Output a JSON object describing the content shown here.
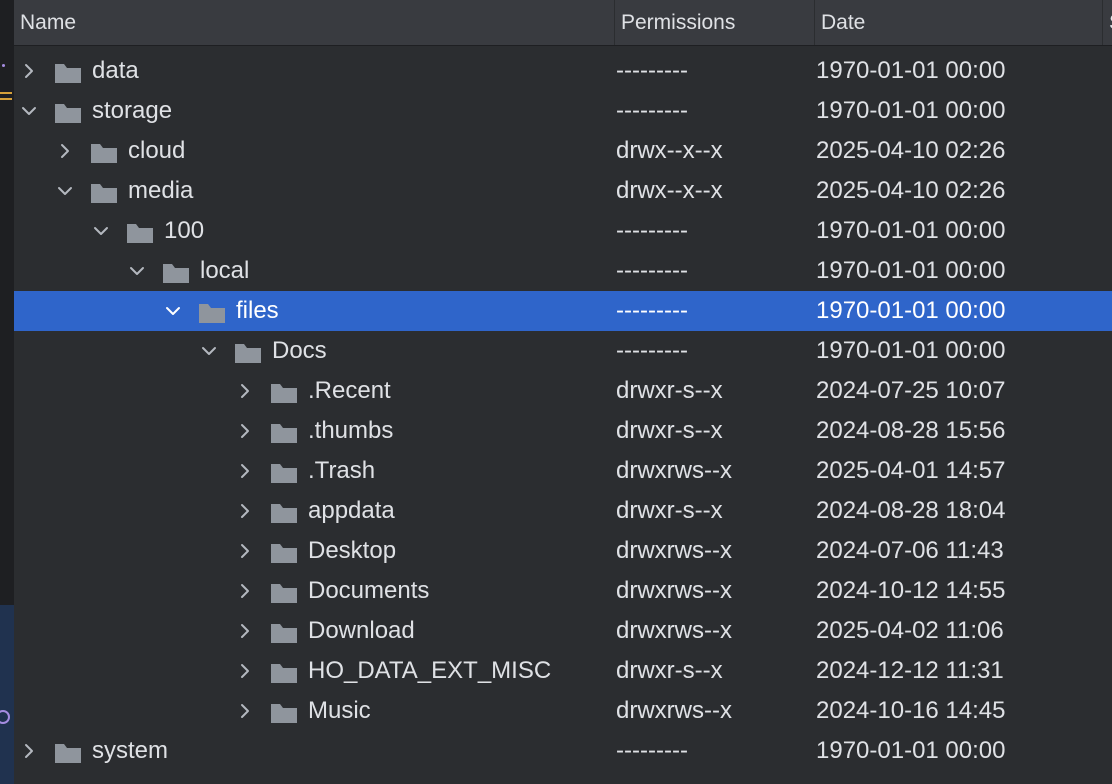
{
  "colors": {
    "background": "#2b2d30",
    "header_background": "#393b40",
    "selection": "#2f65ca",
    "folder_icon": "#8f959d",
    "text": "#dfe1e5"
  },
  "header": {
    "name_label": "Name",
    "permissions_label": "Permissions",
    "date_label": "Date",
    "size_label": "S"
  },
  "rows": [
    {
      "name": "data",
      "permissions": "---------",
      "date": "1970-01-01 00:00",
      "expanded": false,
      "selected": false,
      "icon": "folder-icon"
    },
    {
      "name": "storage",
      "permissions": "---------",
      "date": "1970-01-01 00:00",
      "expanded": true,
      "selected": false,
      "icon": "folder-icon"
    },
    {
      "name": "cloud",
      "permissions": "drwx--x--x",
      "date": "2025-04-10 02:26",
      "expanded": false,
      "selected": false,
      "icon": "folder-icon"
    },
    {
      "name": "media",
      "permissions": "drwx--x--x",
      "date": "2025-04-10 02:26",
      "expanded": true,
      "selected": false,
      "icon": "folder-icon"
    },
    {
      "name": "100",
      "permissions": "---------",
      "date": "1970-01-01 00:00",
      "expanded": true,
      "selected": false,
      "icon": "folder-icon"
    },
    {
      "name": "local",
      "permissions": "---------",
      "date": "1970-01-01 00:00",
      "expanded": true,
      "selected": false,
      "icon": "folder-icon"
    },
    {
      "name": "files",
      "permissions": "---------",
      "date": "1970-01-01 00:00",
      "expanded": true,
      "selected": true,
      "icon": "folder-icon"
    },
    {
      "name": "Docs",
      "permissions": "---------",
      "date": "1970-01-01 00:00",
      "expanded": true,
      "selected": false,
      "icon": "folder-icon"
    },
    {
      "name": ".Recent",
      "permissions": "drwxr-s--x",
      "date": "2024-07-25 10:07",
      "expanded": false,
      "selected": false,
      "icon": "folder-icon"
    },
    {
      "name": ".thumbs",
      "permissions": "drwxr-s--x",
      "date": "2024-08-28 15:56",
      "expanded": false,
      "selected": false,
      "icon": "folder-icon"
    },
    {
      "name": ".Trash",
      "permissions": "drwxrws--x",
      "date": "2025-04-01 14:57",
      "expanded": false,
      "selected": false,
      "icon": "folder-icon"
    },
    {
      "name": "appdata",
      "permissions": "drwxr-s--x",
      "date": "2024-08-28 18:04",
      "expanded": false,
      "selected": false,
      "icon": "folder-icon"
    },
    {
      "name": "Desktop",
      "permissions": "drwxrws--x",
      "date": "2024-07-06 11:43",
      "expanded": false,
      "selected": false,
      "icon": "folder-icon"
    },
    {
      "name": "Documents",
      "permissions": "drwxrws--x",
      "date": "2024-10-12 14:55",
      "expanded": false,
      "selected": false,
      "icon": "folder-icon"
    },
    {
      "name": "Download",
      "permissions": "drwxrws--x",
      "date": "2025-04-02 11:06",
      "expanded": false,
      "selected": false,
      "icon": "folder-icon"
    },
    {
      "name": "HO_DATA_EXT_MISC",
      "permissions": "drwxr-s--x",
      "date": "2024-12-12 11:31",
      "expanded": false,
      "selected": false,
      "icon": "folder-icon"
    },
    {
      "name": "Music",
      "permissions": "drwxrws--x",
      "date": "2024-10-16 14:45",
      "expanded": false,
      "selected": false,
      "icon": "folder-icon"
    },
    {
      "name": "system",
      "permissions": "---------",
      "date": "1970-01-01 00:00",
      "expanded": false,
      "selected": false,
      "icon": "folder-icon"
    }
  ]
}
